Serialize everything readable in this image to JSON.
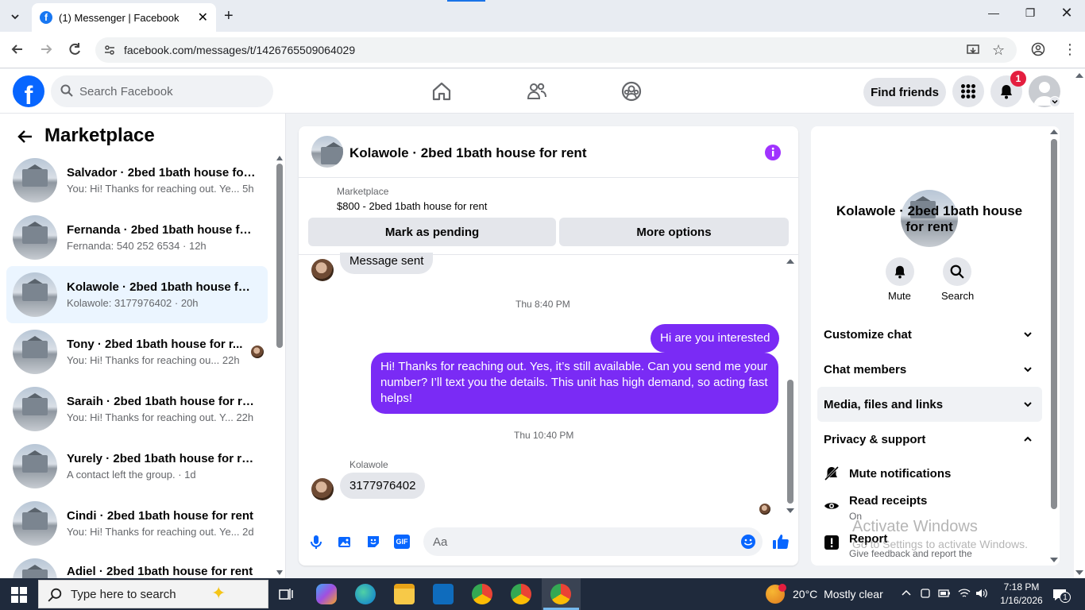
{
  "browser": {
    "tab_title": "(1) Messenger | Facebook",
    "url": "facebook.com/messages/t/1426765509064029"
  },
  "header": {
    "search_placeholder": "Search Facebook",
    "find_friends": "Find friends",
    "notification_count": "1"
  },
  "sidebar": {
    "title": "Marketplace",
    "conversations": [
      {
        "name": "Salvador · 2bed 1bath house for ...",
        "snippet": "You: Hi! Thanks for reaching out. Ye...",
        "time": "5h"
      },
      {
        "name": "Fernanda · 2bed 1bath house for...",
        "snippet": "Fernanda: 540 252 6534",
        "time": "12h"
      },
      {
        "name": "Kolawole · 2bed 1bath house for...",
        "snippet": "Kolawole: 3177976402",
        "time": "20h"
      },
      {
        "name": "Tony · 2bed 1bath house for r...",
        "snippet": "You: Hi! Thanks for reaching ou...",
        "time": "22h"
      },
      {
        "name": "Saraih · 2bed 1bath house for rent",
        "snippet": "You: Hi! Thanks for reaching out. Y...",
        "time": "22h"
      },
      {
        "name": "Yurely · 2bed 1bath house for rent",
        "snippet": "A contact left the group.",
        "time": "1d"
      },
      {
        "name": "Cindi · 2bed 1bath house for rent",
        "snippet": "You: Hi! Thanks for reaching out. Ye...",
        "time": "2d"
      },
      {
        "name": "Adiel · 2bed 1bath house for rent",
        "snippet": "",
        "time": ""
      }
    ]
  },
  "chat": {
    "title": "Kolawole · 2bed 1bath house for rent",
    "listing_source": "Marketplace",
    "listing": "$800 - 2bed 1bath house for rent",
    "mark_pending": "Mark as pending",
    "more_options": "More options",
    "messages": {
      "sent_notice": "Message sent",
      "ts1": "Thu 8:40 PM",
      "out1": "Hi are you interested",
      "out2": "Hi! Thanks for reaching out. Yes, it’s still available. Can you send me your number? I’ll text you the details. This unit has high demand, so acting fast helps!",
      "ts2": "Thu 10:40 PM",
      "sender": "Kolawole",
      "in1": "3177976402"
    },
    "composer_placeholder": "Aa",
    "gif_label": "GIF"
  },
  "info": {
    "name": "Kolawole · 2bed 1bath house for rent",
    "mute": "Mute",
    "search": "Search",
    "customize": "Customize chat",
    "members": "Chat members",
    "media": "Media, files and links",
    "privacy": "Privacy & support",
    "mute_notifications": "Mute notifications",
    "read_receipts": "Read receipts",
    "read_receipts_state": "On",
    "report": "Report",
    "report_sub": "Give feedback and report the"
  },
  "watermark": {
    "title": "Activate Windows",
    "sub": "Go to Settings to activate Windows."
  },
  "taskbar": {
    "search_placeholder": "Type here to search",
    "weather_temp": "20°C",
    "weather_desc": "Mostly clear",
    "time": "7:18 PM",
    "date": "1/16/2026",
    "notif_badge": "1"
  },
  "colors": {
    "brand": "#0866ff",
    "outgoing_bubble": "#7a2bf5",
    "active_conv": "#ebf5ff"
  }
}
